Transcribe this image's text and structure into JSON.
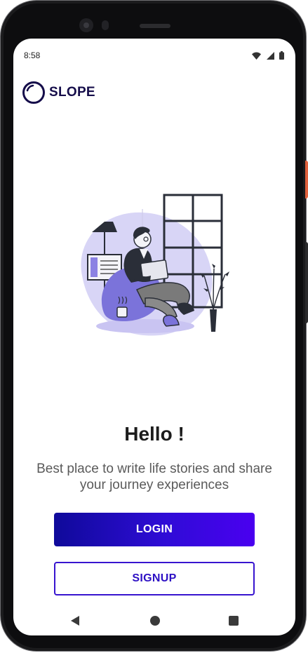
{
  "status_bar": {
    "time": "8:58",
    "icons": [
      "wifi-icon",
      "signal-icon",
      "battery-icon"
    ]
  },
  "brand": {
    "name": "SLOPE",
    "logo_icon": "ring-logo-icon",
    "color": "#150d4a"
  },
  "illustration": {
    "icon": "person-relaxing-with-laptop-illustration",
    "accent_color": "#8b82e3"
  },
  "welcome": {
    "heading": "Hello !",
    "subtitle": "Best place to write life stories and share your journey experiences"
  },
  "actions": {
    "login_label": "LOGIN",
    "signup_label": "SIGNUP",
    "primary_color": "#2f0cd6"
  },
  "nav_bar": {
    "items": [
      "back-icon",
      "home-icon",
      "recents-icon"
    ]
  }
}
